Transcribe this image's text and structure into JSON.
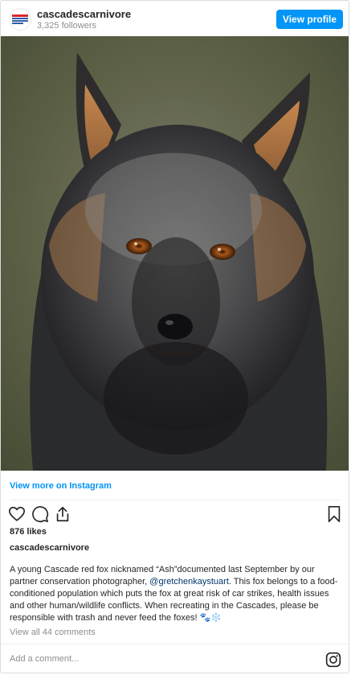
{
  "header": {
    "username": "cascadescarnivore",
    "followers": "3,325 followers",
    "view_profile_label": "View profile",
    "avatar_text": "CASCADES CARNIVORE PROJECT"
  },
  "post": {
    "photo_alt": "fox-photo",
    "view_more_label": "View more on Instagram",
    "likes": "876 likes",
    "caption_user": "cascadescarnivore",
    "caption_part1": "A young Cascade red fox nicknamed “Ash”documented last September by our partner conservation photographer, ",
    "caption_mention": "@gretchenkaystuart",
    "caption_part2": ". This fox belongs to a food-conditioned population which puts the fox at great risk of car strikes, health issues and other human/wildlife conflicts. When recreating in the Cascades, please be responsible with trash and never feed the foxes! 🐾❄️",
    "view_comments": "View all 44 comments",
    "add_comment_placeholder": "Add a comment..."
  },
  "icons": {
    "like": "heart-icon",
    "comment": "comment-icon",
    "share": "share-icon",
    "save": "bookmark-icon",
    "instagram": "instagram-icon"
  },
  "colors": {
    "accent": "#0095f6",
    "mention": "#00376b",
    "muted": "#8e8e8e"
  }
}
